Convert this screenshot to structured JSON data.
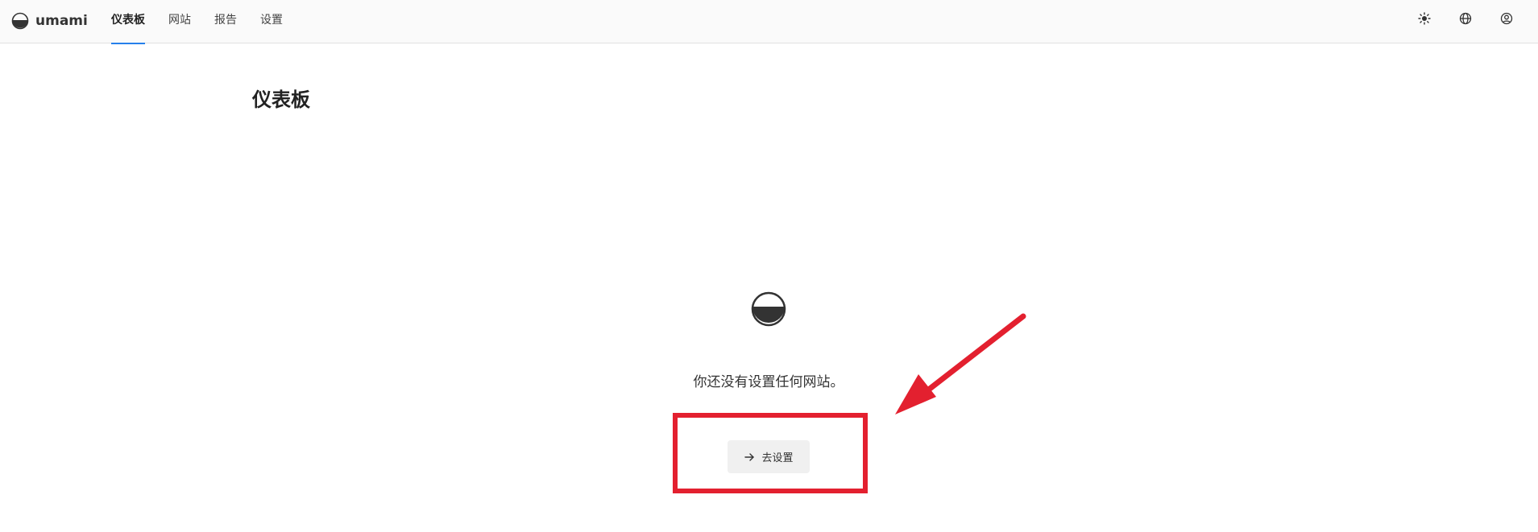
{
  "app": {
    "name": "umami"
  },
  "nav": {
    "items": [
      {
        "label": "仪表板",
        "active": true
      },
      {
        "label": "网站",
        "active": false
      },
      {
        "label": "报告",
        "active": false
      },
      {
        "label": "设置",
        "active": false
      }
    ]
  },
  "header_icons": [
    "sun-icon",
    "globe-icon",
    "user-icon"
  ],
  "page": {
    "title": "仪表板"
  },
  "empty_state": {
    "message": "你还没有设置任何网站。",
    "button_label": "去设置"
  },
  "colors": {
    "accent": "#2680eb",
    "annotation": "#e3202f"
  }
}
